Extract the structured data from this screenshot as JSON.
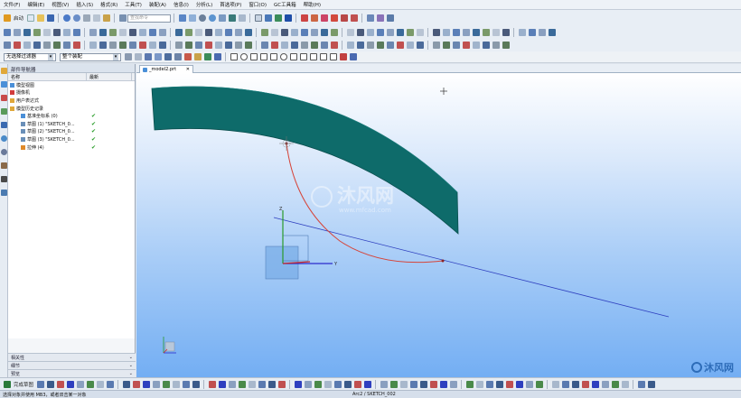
{
  "menubar": {
    "items": [
      "文件(F)",
      "编辑(E)",
      "视图(V)",
      "插入(S)",
      "格式(R)",
      "工具(T)",
      "装配(A)",
      "信息(I)",
      "分析(L)",
      "首选项(P)",
      "窗口(O)",
      "GC工具箱",
      "帮助(H)"
    ]
  },
  "toolbar": {
    "start_label": "启动",
    "search_placeholder": "查找命令",
    "filter_value": "无选择过滤器",
    "assembly_scope_value": "整个装配",
    "finish_sketch_label": "完成草图"
  },
  "nav": {
    "title": "部件导航器",
    "col_name": "名称",
    "col_latest": "最新",
    "rows": [
      {
        "label": "模型视图",
        "indent": 2,
        "icon": "#4a8fd8",
        "check": ""
      },
      {
        "label": "摄像机",
        "indent": 2,
        "icon": "#d23c3c",
        "check": ""
      },
      {
        "label": "用户表达式",
        "indent": 2,
        "icon": "#e0a83a",
        "check": ""
      },
      {
        "label": "模型历史记录",
        "indent": 2,
        "icon": "#e0a83a",
        "check": ""
      },
      {
        "label": "基准坐标系 (0)",
        "indent": 14,
        "icon": "#4a8fd8",
        "check": "✔"
      },
      {
        "label": "草图 (1) \"SKETCH_0...",
        "indent": 14,
        "icon": "#6a8fb8",
        "check": "✔"
      },
      {
        "label": "草图 (2) \"SKETCH_0...",
        "indent": 14,
        "icon": "#6a8fb8",
        "check": "✔"
      },
      {
        "label": "草图 (3) \"SKETCH_0...",
        "indent": 14,
        "icon": "#6a8fb8",
        "check": "✔"
      },
      {
        "label": "拉伸 (4)",
        "indent": 14,
        "icon": "#e08a2a",
        "check": "✔"
      }
    ],
    "panels": [
      "相关性",
      "细节",
      "预览"
    ]
  },
  "tabs": {
    "active_label": "_model2.prt"
  },
  "status": {
    "left": "选择对象并使用 MB3，或者双击某一对象",
    "center": "Arc2 / SKETCH_002"
  },
  "watermark": {
    "logo_text": "沐风网"
  },
  "colors": {
    "accent": "#2d6cb8",
    "solid_body": "#0e6b6a",
    "arc": "#d6453a",
    "line": "#2e3fbf"
  }
}
